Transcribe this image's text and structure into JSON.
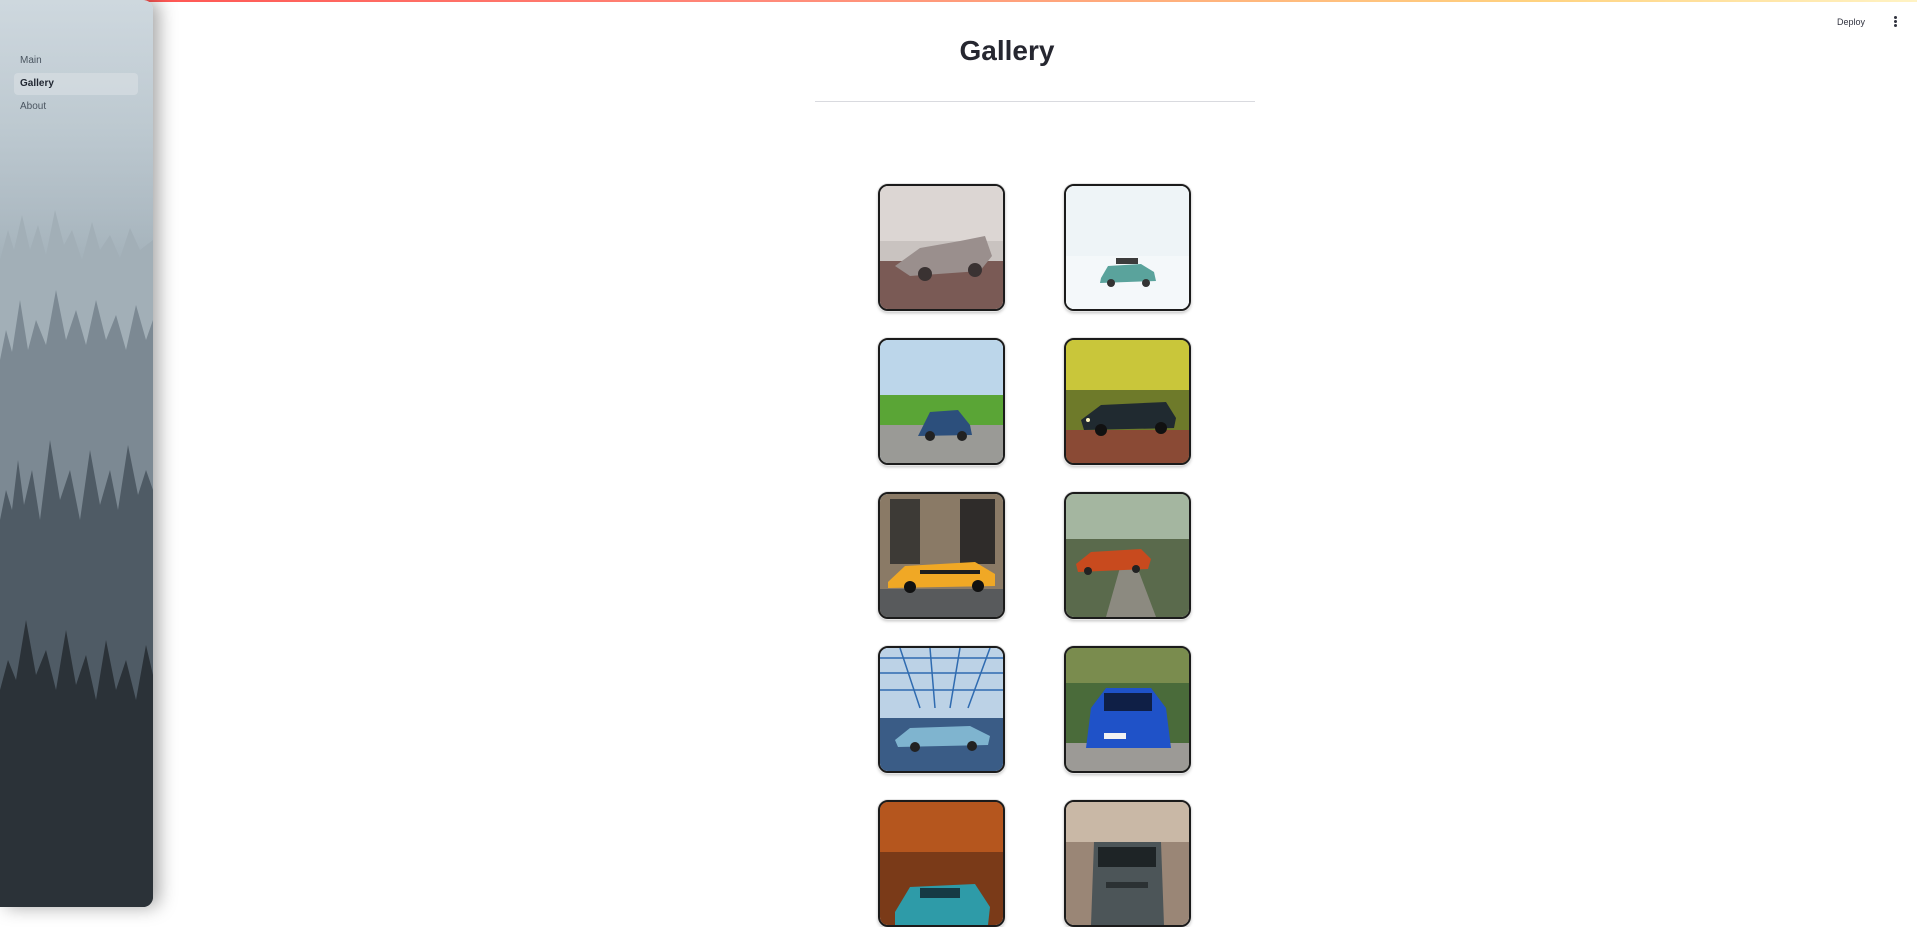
{
  "sidebar": {
    "items": [
      {
        "label": "Main",
        "active": false
      },
      {
        "label": "Gallery",
        "active": true
      },
      {
        "label": "About",
        "active": false
      }
    ]
  },
  "header": {
    "deploy_label": "Deploy",
    "menu_icon": "kebab-menu-icon"
  },
  "main": {
    "title": "Gallery",
    "images": [
      {
        "name": "vintage-silver-finned-car"
      },
      {
        "name": "teal-car-in-snow"
      },
      {
        "name": "blue-beetle-green-field"
      },
      {
        "name": "dark-truck-forest"
      },
      {
        "name": "yellow-muscle-car-city"
      },
      {
        "name": "orange-car-forest-path"
      },
      {
        "name": "blue-classic-car-grid"
      },
      {
        "name": "blue-bmw-sedan"
      },
      {
        "name": "teal-sports-car-autumn"
      },
      {
        "name": "gray-suv-desert"
      }
    ]
  },
  "colors": {
    "accent": "#ff4b4b",
    "text": "#31333f"
  }
}
